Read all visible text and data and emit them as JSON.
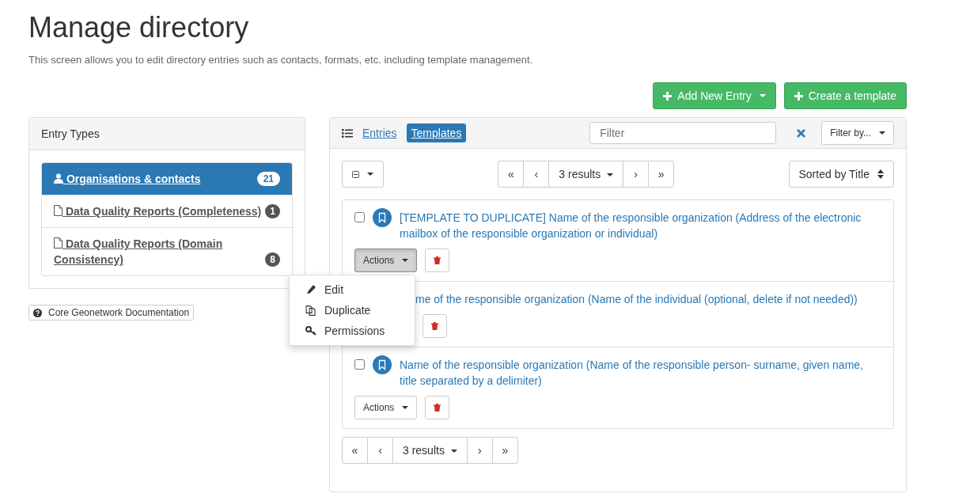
{
  "page": {
    "title": "Manage directory",
    "description": "This screen allows you to edit directory entries such as contacts, formats, etc. including template management."
  },
  "toolbar": [
    {
      "label": "Add New Entry",
      "caret": true
    },
    {
      "label": "Create a template",
      "caret": false
    }
  ],
  "entry_types": {
    "title": "Entry Types",
    "items": [
      {
        "kind": "contact",
        "label": " Organisations & contacts",
        "count": "21",
        "selected": true
      },
      {
        "kind": "document",
        "label": " Data Quality Reports (Completeness)",
        "count": "1",
        "selected": false
      },
      {
        "kind": "document",
        "label": " Data Quality Reports (Domain Consistency)",
        "count": "8",
        "selected": false
      }
    ]
  },
  "doc_link": "Core Geonetwork Documentation",
  "tabs": [
    {
      "label": "Entries",
      "selected": false
    },
    {
      "label": "Templates",
      "selected": true
    }
  ],
  "filter": {
    "placeholder": "Filter"
  },
  "filter_by": "Filter by...",
  "pager_top": {
    "first": "«",
    "prev": "‹",
    "results": "3 results",
    "next": "›",
    "last": "»"
  },
  "sort": "Sorted by Title",
  "records": [
    {
      "kind": "full",
      "checked": false,
      "title": "[TEMPLATE TO DUPLICATE] Name of the responsible organization (Address of the electronic mailbox of the responsible organization or individual)",
      "actions": "Actions",
      "pressed": true
    },
    {
      "kind": "partly_hidden",
      "title": "me of the responsible organization (Name of the individual (optional, delete if not needed))"
    },
    {
      "kind": "full",
      "checked": false,
      "title": "Name of the responsible organization (Name of the responsible person- surname, given name, title separated by a delimiter)",
      "actions": "Actions",
      "pressed": false
    }
  ],
  "menu": [
    {
      "kind": "edit",
      "label": "Edit"
    },
    {
      "kind": "duplicate",
      "label": "Duplicate"
    },
    {
      "kind": "permissions",
      "label": "Permissions"
    }
  ],
  "pager_bottom": {
    "first": "«",
    "prev": "‹",
    "results": "3 results",
    "next": "›",
    "last": "»"
  }
}
